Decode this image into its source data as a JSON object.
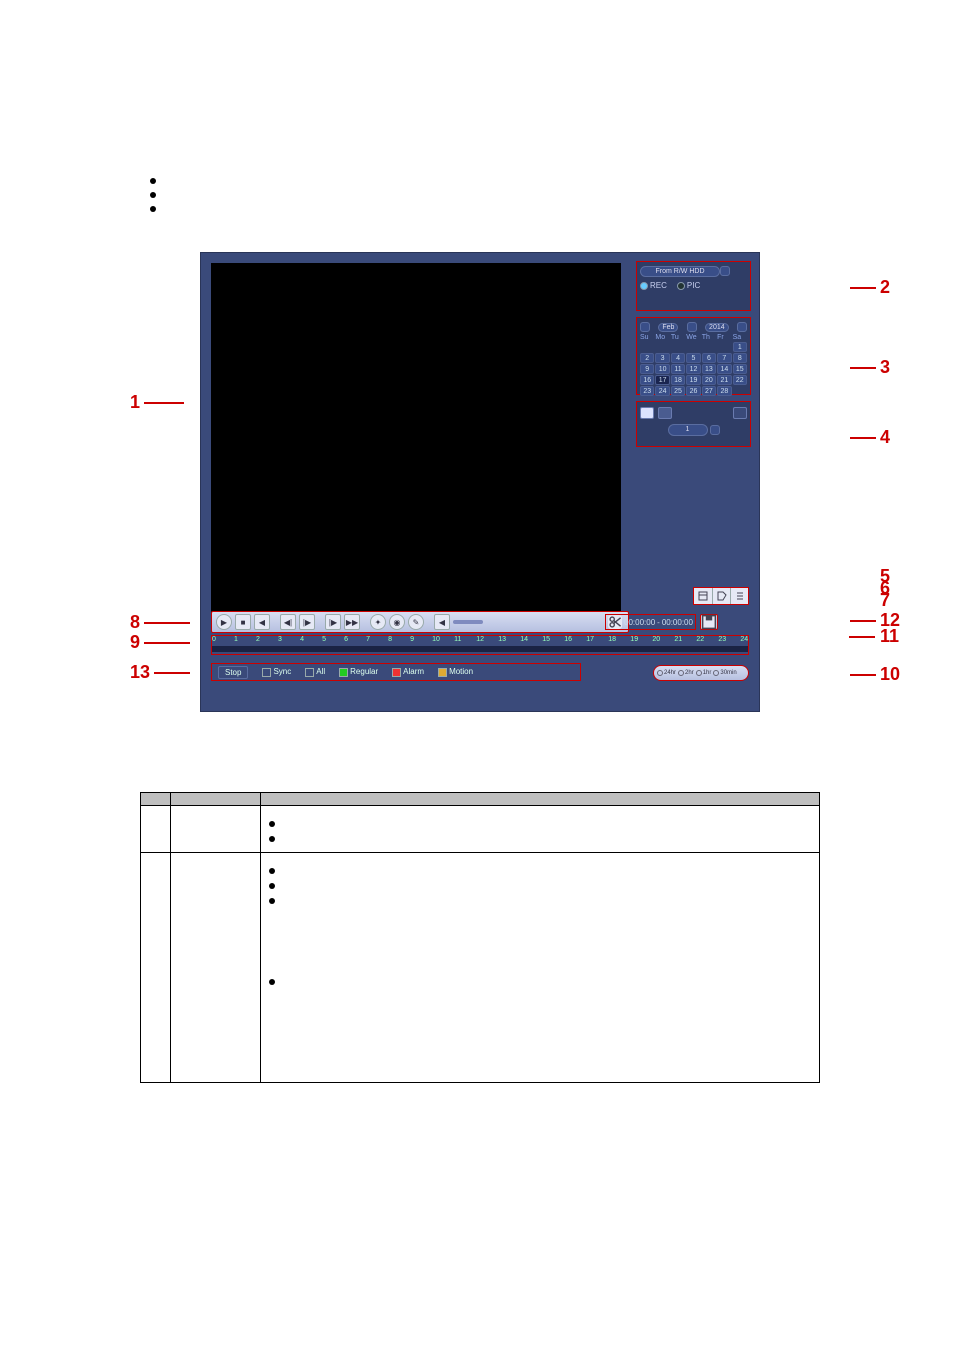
{
  "top_bullets": [
    "",
    "",
    ""
  ],
  "player": {
    "source_label": "From R/W HDD",
    "rec_label": "REC",
    "pic_label": "PIC",
    "calendar": {
      "month": "Feb",
      "year": "2014",
      "days_header": [
        "Su",
        "Mo",
        "Tu",
        "We",
        "Th",
        "Fr",
        "Sa"
      ],
      "weeks": [
        [
          "",
          "",
          "",
          "",
          "",
          "",
          "1"
        ],
        [
          "2",
          "3",
          "4",
          "5",
          "6",
          "7",
          "8"
        ],
        [
          "9",
          "10",
          "11",
          "12",
          "13",
          "14",
          "15"
        ],
        [
          "16",
          "17",
          "18",
          "19",
          "20",
          "21",
          "22"
        ],
        [
          "23",
          "24",
          "25",
          "26",
          "27",
          "28",
          ""
        ]
      ],
      "selected_day": "17"
    },
    "channel": "1",
    "time_start": "00:00:00",
    "time_end": "00:00:00",
    "timeline_hours": [
      "0",
      "1",
      "2",
      "3",
      "4",
      "5",
      "6",
      "7",
      "8",
      "9",
      "10",
      "11",
      "12",
      "13",
      "14",
      "15",
      "16",
      "17",
      "18",
      "19",
      "20",
      "21",
      "22",
      "23",
      "24"
    ],
    "legend": {
      "stop": "Stop",
      "sync": "Sync",
      "all": "All",
      "regular": "Regular",
      "alarm": "Alarm",
      "motion": "Motion"
    },
    "zoom": {
      "o24hr": "24hr",
      "o2hr": "2hr",
      "o1hr": "1hr",
      "o30min": "30min"
    }
  },
  "callouts": {
    "c1": "1",
    "c2": "2",
    "c3": "3",
    "c4": "4",
    "c5": "5",
    "c6": "6",
    "c7": "7",
    "c8": "8",
    "c9": "9",
    "c10": "10",
    "c11": "11",
    "c12": "12",
    "c13": "13"
  },
  "table": {
    "head": {
      "sn": "",
      "name": "",
      "func": ""
    },
    "rows": [
      {
        "sn": "",
        "name": "",
        "bullets": [
          "",
          ""
        ]
      },
      {
        "sn": "",
        "name": "",
        "bullets": [
          "",
          "",
          "",
          ""
        ]
      }
    ]
  }
}
